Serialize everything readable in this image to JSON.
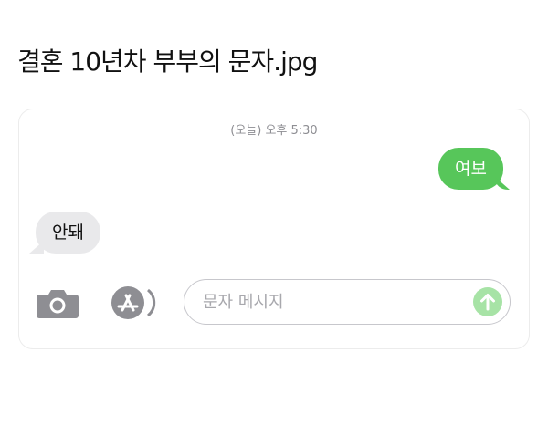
{
  "post": {
    "title": "결혼 10년차 부부의 문자.jpg"
  },
  "conversation": {
    "timestamp": "(오늘) 오후 5:30",
    "messages": [
      {
        "direction": "outgoing",
        "text": "여보"
      },
      {
        "direction": "incoming",
        "text": "안돼"
      }
    ]
  },
  "composer": {
    "placeholder": "문자 메시지",
    "value": "",
    "camera_icon": "camera-icon",
    "apps_icon": "app-store-icon",
    "send_icon": "send-arrow-up-icon"
  },
  "colors": {
    "outgoing_bubble": "#57c65a",
    "incoming_bubble": "#e9e9eb",
    "send_button_disabled": "#a7e3a6",
    "icon_gray": "#8e8e93"
  }
}
